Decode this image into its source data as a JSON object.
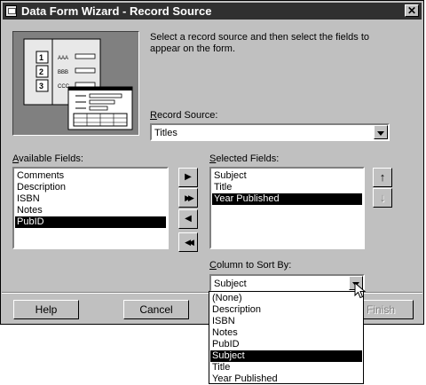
{
  "window": {
    "title": "Data Form Wizard - Record Source",
    "close_label": "✕"
  },
  "intro": {
    "line1": "Select a record source and then select the fields to",
    "line2": "appear on the form."
  },
  "illustration": {
    "rows": [
      {
        "num": "1",
        "text": "AAA"
      },
      {
        "num": "2",
        "text": "BBB"
      },
      {
        "num": "3",
        "text": "CCC"
      }
    ]
  },
  "record_source": {
    "label_accel": "R",
    "label_rest": "ecord Source:",
    "value": "Titles"
  },
  "available_fields": {
    "label_accel": "A",
    "label_rest": "vailable Fields:",
    "items": [
      "Comments",
      "Description",
      "ISBN",
      "Notes",
      "PubID"
    ],
    "selected_index": 4
  },
  "selected_fields": {
    "label_accel": "S",
    "label_rest": "elected Fields:",
    "items": [
      "Subject",
      "Title",
      "Year Published"
    ],
    "selected_index": 2
  },
  "transfer_buttons": {
    "add_one": "▶",
    "add_all": "▶▶",
    "remove_one": "◀",
    "remove_all": "◀◀"
  },
  "order_buttons": {
    "move_up": "↑",
    "move_down": "↓"
  },
  "sort": {
    "label_accel": "C",
    "label_rest": "olumn to Sort By:",
    "value": "Subject",
    "options": [
      "(None)",
      "Description",
      "ISBN",
      "Notes",
      "PubID",
      "Subject",
      "Title",
      "Year Published"
    ],
    "selected_index": 5
  },
  "footer_buttons": {
    "help": "Help",
    "cancel": "Cancel",
    "finish": "Finish"
  }
}
